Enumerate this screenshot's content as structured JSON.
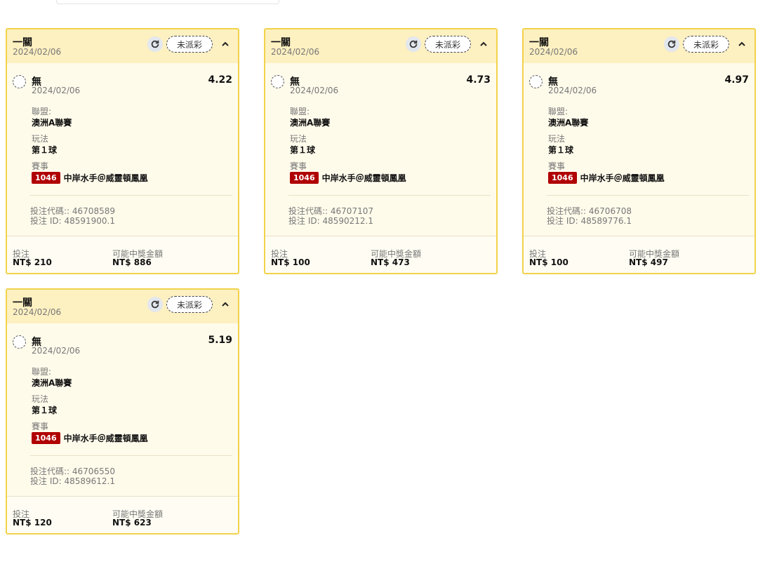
{
  "colors": {
    "accent_border": "#f2d24b",
    "header_bg": "#fdf0c1",
    "event_badge": "#b00000"
  },
  "icons": {
    "refresh": "refresh-icon",
    "collapse": "chevron-up-icon"
  },
  "labels": {
    "league": "聯盟:",
    "play_type": "玩法",
    "event": "賽事",
    "stake": "投注",
    "potential_win": "可能中獎金額"
  },
  "bets": [
    {
      "type": "一關",
      "date": "2024/02/06",
      "status": "未派彩",
      "selection": "無",
      "selection_date": "2024/02/06",
      "odds": "4.22",
      "league": "澳洲A聯賽",
      "play": "第１球",
      "event_id": "1046",
      "event_name": "中岸水手＠威靈頓鳳凰",
      "bet_code": "投注代碼:: 46708589",
      "bet_id": "投注 ID: 48591900.1",
      "stake": "NT$ 210",
      "potential_win": "NT$ 886"
    },
    {
      "type": "一關",
      "date": "2024/02/06",
      "status": "未派彩",
      "selection": "無",
      "selection_date": "2024/02/06",
      "odds": "4.73",
      "league": "澳洲A聯賽",
      "play": "第１球",
      "event_id": "1046",
      "event_name": "中岸水手＠威靈頓鳳凰",
      "bet_code": "投注代碼:: 46707107",
      "bet_id": "投注 ID: 48590212.1",
      "stake": "NT$ 100",
      "potential_win": "NT$ 473"
    },
    {
      "type": "一關",
      "date": "2024/02/06",
      "status": "未派彩",
      "selection": "無",
      "selection_date": "2024/02/06",
      "odds": "4.97",
      "league": "澳洲A聯賽",
      "play": "第１球",
      "event_id": "1046",
      "event_name": "中岸水手＠威靈頓鳳凰",
      "bet_code": "投注代碼:: 46706708",
      "bet_id": "投注 ID: 48589776.1",
      "stake": "NT$ 100",
      "potential_win": "NT$ 497"
    },
    {
      "type": "一關",
      "date": "2024/02/06",
      "status": "未派彩",
      "selection": "無",
      "selection_date": "2024/02/06",
      "odds": "5.19",
      "league": "澳洲A聯賽",
      "play": "第１球",
      "event_id": "1046",
      "event_name": "中岸水手＠威靈頓鳳凰",
      "bet_code": "投注代碼:: 46706550",
      "bet_id": "投注 ID: 48589612.1",
      "stake": "NT$ 120",
      "potential_win": "NT$ 623"
    }
  ]
}
